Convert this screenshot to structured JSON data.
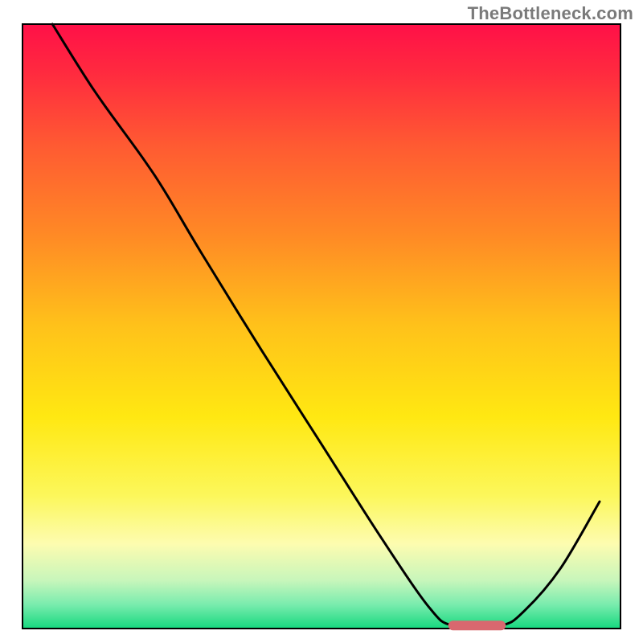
{
  "watermark": "TheBottleneck.com",
  "chart_data": {
    "type": "line",
    "title": "",
    "xlabel": "",
    "ylabel": "",
    "xlim": [
      0,
      100
    ],
    "ylim": [
      0,
      100
    ],
    "curve_points": [
      {
        "x": 5.0,
        "y": 100.0
      },
      {
        "x": 12.0,
        "y": 89.0
      },
      {
        "x": 20.0,
        "y": 78.0
      },
      {
        "x": 24.0,
        "y": 72.0
      },
      {
        "x": 30.0,
        "y": 62.0
      },
      {
        "x": 40.0,
        "y": 46.0
      },
      {
        "x": 50.0,
        "y": 30.5
      },
      {
        "x": 60.0,
        "y": 15.0
      },
      {
        "x": 68.0,
        "y": 3.5
      },
      {
        "x": 72.0,
        "y": 0.5
      },
      {
        "x": 80.0,
        "y": 0.5
      },
      {
        "x": 84.0,
        "y": 3.0
      },
      {
        "x": 90.0,
        "y": 10.0
      },
      {
        "x": 96.5,
        "y": 21.0
      }
    ],
    "marker_segment": {
      "x_start": 72,
      "x_end": 80,
      "y": 0.5
    },
    "gradient_stops": [
      {
        "offset": 0.0,
        "color": "#ff1048"
      },
      {
        "offset": 0.08,
        "color": "#ff2a3f"
      },
      {
        "offset": 0.2,
        "color": "#ff5a32"
      },
      {
        "offset": 0.35,
        "color": "#ff8a25"
      },
      {
        "offset": 0.5,
        "color": "#ffc21a"
      },
      {
        "offset": 0.65,
        "color": "#ffe812"
      },
      {
        "offset": 0.78,
        "color": "#fcf75b"
      },
      {
        "offset": 0.86,
        "color": "#fdfcb0"
      },
      {
        "offset": 0.92,
        "color": "#c8f6bb"
      },
      {
        "offset": 0.96,
        "color": "#7aecae"
      },
      {
        "offset": 1.0,
        "color": "#16d87f"
      }
    ],
    "frame_color": "#000000",
    "curve_color": "#000000",
    "marker_color": "#d9686f",
    "background_color": "#ffffff"
  }
}
